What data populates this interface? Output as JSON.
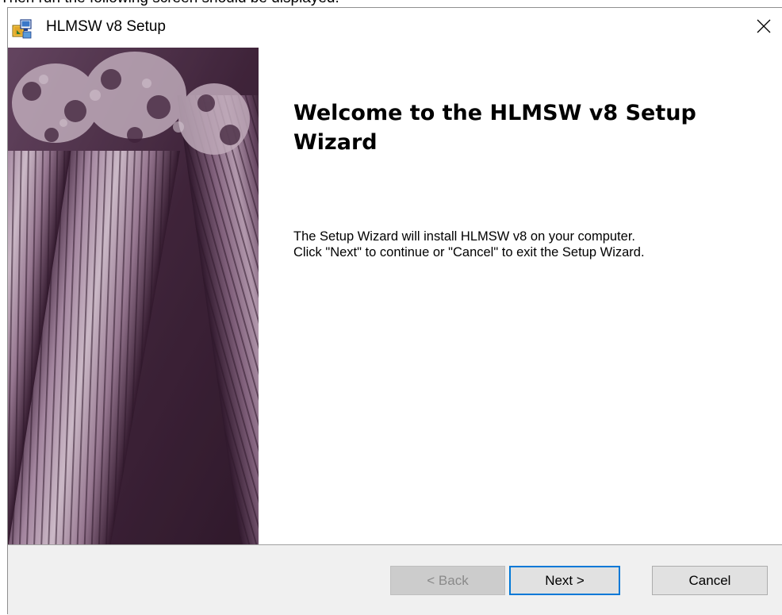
{
  "document_snippet": "Then run the following screen should be displayed.",
  "window": {
    "title": "HLMSW v8 Setup"
  },
  "icons": {
    "app": "setup-installer-icon",
    "close": "close-icon"
  },
  "welcome": {
    "heading": "Welcome to the HLMSW v8 Setup Wizard",
    "description_line1": "The Setup Wizard will install HLMSW v8 on your computer.",
    "description_line2": "Click \"Next\" to continue or \"Cancel\" to exit the Setup Wizard."
  },
  "buttons": {
    "back": "< Back",
    "next": "Next >",
    "cancel": "Cancel"
  },
  "colors": {
    "banner_tint": "#4a2a44",
    "focus_border": "#0078d7",
    "footer_bg": "#f0f0f0"
  }
}
